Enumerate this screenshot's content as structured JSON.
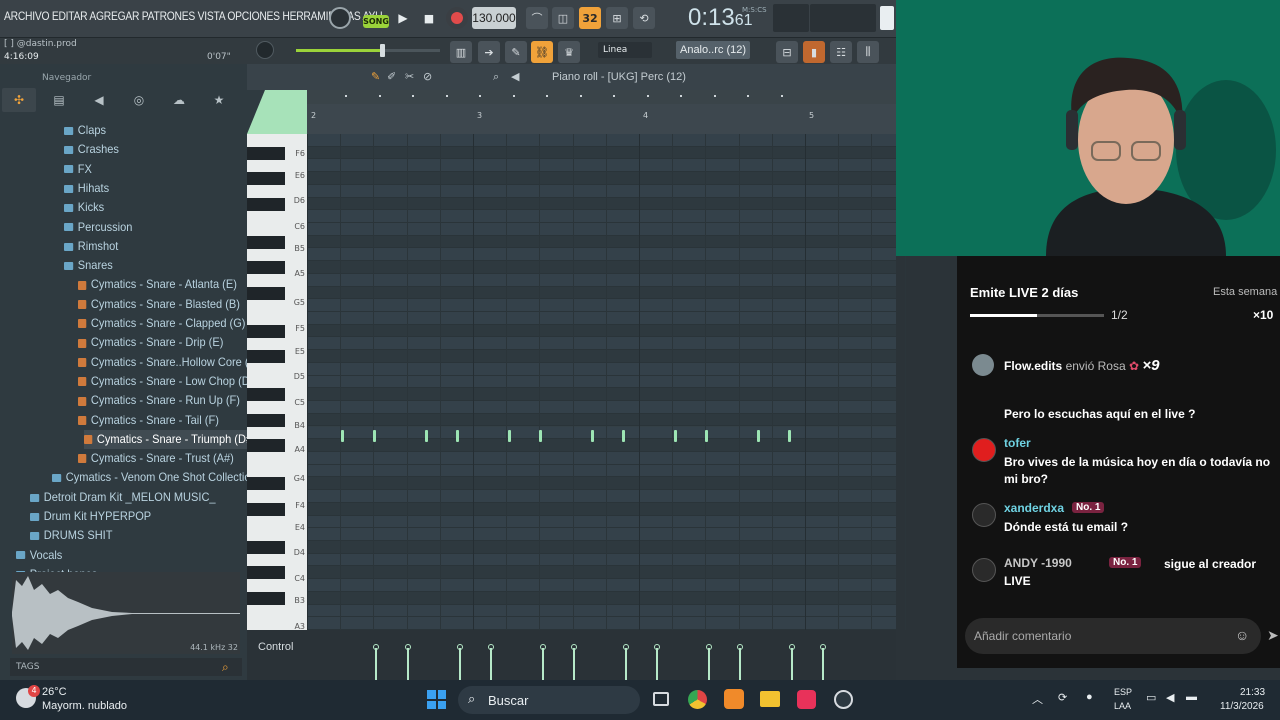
{
  "toolbar": {
    "menu": "ARCHIVO EDITAR AGREGAR PATRONES VISTA OPCIONES HERRAMIENTAS AYU",
    "song_label": "SONG",
    "tempo": "130.000",
    "time_main": "0:13",
    "time_sub": "61",
    "time_unit": "M:S:CS",
    "snap": "32",
    "hint_user": "@dastin.prod",
    "hint_position": "4:16:09",
    "hint_time": "0'07\"",
    "stamp_mode": "Linea",
    "channel": "Analo..rc (12)"
  },
  "browser": {
    "header": "Navegador",
    "items": [
      {
        "label": "Claps",
        "type": "folder",
        "indent": 1
      },
      {
        "label": "Crashes",
        "type": "folder",
        "indent": 1
      },
      {
        "label": "FX",
        "type": "folder",
        "indent": 1
      },
      {
        "label": "Hihats",
        "type": "folder",
        "indent": 1
      },
      {
        "label": "Kicks",
        "type": "folder",
        "indent": 1
      },
      {
        "label": "Percussion",
        "type": "folder",
        "indent": 1
      },
      {
        "label": "Rimshot",
        "type": "folder",
        "indent": 1
      },
      {
        "label": "Snares",
        "type": "folder",
        "indent": 1
      },
      {
        "label": "Cymatics - Snare - Atlanta (E)",
        "type": "sample",
        "indent": 2
      },
      {
        "label": "Cymatics - Snare - Blasted (B)",
        "type": "sample",
        "indent": 2
      },
      {
        "label": "Cymatics - Snare - Clapped (G)",
        "type": "sample",
        "indent": 2
      },
      {
        "label": "Cymatics - Snare - Drip (E)",
        "type": "sample",
        "indent": 2
      },
      {
        "label": "Cymatics - Snare..Hollow Core (F#)",
        "type": "sample",
        "indent": 2
      },
      {
        "label": "Cymatics - Snare - Low Chop (D)",
        "type": "sample",
        "indent": 2
      },
      {
        "label": "Cymatics - Snare - Run Up (F)",
        "type": "sample",
        "indent": 2
      },
      {
        "label": "Cymatics - Snare - Tail (F)",
        "type": "sample",
        "indent": 2
      },
      {
        "label": "Cymatics - Snare - Triumph (D#)",
        "type": "sample",
        "indent": 3,
        "selected": true
      },
      {
        "label": "Cymatics - Snare - Trust (A#)",
        "type": "sample",
        "indent": 2
      },
      {
        "label": "Cymatics - Venom One Shot Collection",
        "type": "folder",
        "indent": 0
      },
      {
        "label": "Detroit Dram Kit _MELON MUSIC_",
        "type": "folder",
        "indent": -1
      },
      {
        "label": "Drum Kit HYPERPOP",
        "type": "folder",
        "indent": -1
      },
      {
        "label": "DRUMS SHIT",
        "type": "folder",
        "indent": -1
      },
      {
        "label": "Vocals",
        "type": "folder",
        "indent": -2
      },
      {
        "label": "Project bones",
        "type": "folder",
        "indent": -3
      }
    ],
    "sample_rate": "44.1 kHz 32",
    "tags_label": "TAGS"
  },
  "piano_roll": {
    "title": "Piano roll - [UKG] Perc (12)",
    "ruler_numbers": [
      "2",
      "3",
      "4",
      "5"
    ],
    "key_labels": [
      "F6",
      "E6",
      "D6",
      "C6",
      "B5",
      "A5",
      "G5",
      "F5",
      "E5",
      "D5",
      "C5",
      "B4",
      "A4",
      "G4",
      "F4",
      "E4",
      "D4",
      "C4",
      "B3",
      "A3"
    ],
    "note_count": 12,
    "control_label": "Control"
  },
  "tiktok": {
    "goal_title": "Emite LIVE 2 días",
    "goal_progress": "1/2",
    "goal_progress_fraction": 0.5,
    "goal_side": "Esta semana",
    "goal_reward": "×10",
    "gift_user": "Flow.edits",
    "gift_text": "envió Rosa",
    "gift_count": "×9",
    "messages": [
      {
        "user": "",
        "text": "Pero lo escuchas aquí en el live ?"
      },
      {
        "user": "tofer",
        "text": "Bro vives de la música hoy en día o todavía no mi bro?"
      },
      {
        "user": "xanderdxa",
        "badge": "No. 1",
        "text": "Dónde está tu email ?"
      },
      {
        "user": "ANDY -1990",
        "badge": "No. 1",
        "text": "sigue al creador LIVE"
      }
    ],
    "comment_placeholder": "Añadir comentario"
  },
  "taskbar": {
    "weather_temp": "26°C",
    "weather_desc": "Mayorm. nublado",
    "weather_badge": "4",
    "search_label": "Buscar",
    "lang_1": "ESP",
    "lang_2": "LAA",
    "time": "21:33",
    "date": "11/3/2026"
  }
}
